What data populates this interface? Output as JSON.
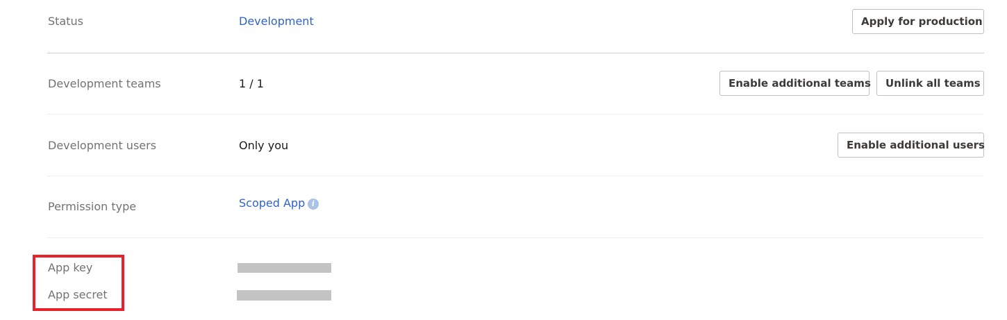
{
  "status": {
    "label": "Status",
    "value": "Development",
    "button": "Apply for production"
  },
  "dev_teams": {
    "label": "Development teams",
    "value": "1 / 1",
    "enable_button": "Enable additional teams",
    "unlink_button": "Unlink all teams"
  },
  "dev_users": {
    "label": "Development users",
    "value": "Only you",
    "button": "Enable additional users"
  },
  "permission": {
    "label": "Permission type",
    "value": "Scoped App",
    "info_icon": "info-icon",
    "info_glyph": "i"
  },
  "app_key": {
    "label": "App key"
  },
  "app_secret": {
    "label": "App secret"
  },
  "colors": {
    "link": "#2f63c8",
    "label": "#747270",
    "highlight": "#e8222a",
    "redaction": "#c4c4c4"
  }
}
